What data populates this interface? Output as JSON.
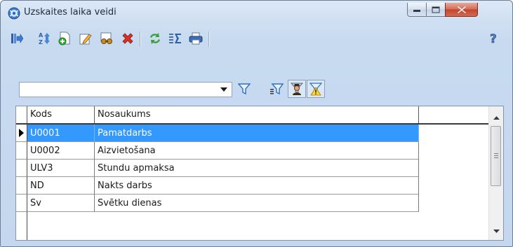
{
  "window": {
    "title": "Uzskaites laika veidi",
    "controls": {
      "minimize": "minimize-icon",
      "maximize": "maximize-icon",
      "close": "close-icon"
    }
  },
  "toolbar": {
    "buttons": [
      {
        "name": "export-icon"
      },
      {
        "name": "sort-az-icon"
      },
      {
        "name": "new-record-icon"
      },
      {
        "name": "edit-icon"
      },
      {
        "name": "view-icon"
      },
      {
        "name": "delete-icon"
      },
      {
        "name": "refresh-icon"
      },
      {
        "name": "sum-icon"
      },
      {
        "name": "print-icon"
      },
      {
        "name": "help-icon"
      }
    ]
  },
  "filter": {
    "combo_value": "",
    "buttons": [
      {
        "name": "filter-icon"
      },
      {
        "name": "filter-list-icon"
      },
      {
        "name": "user-filter-icon",
        "pressed": true
      },
      {
        "name": "warning-filter-icon",
        "pressed": true
      }
    ]
  },
  "grid": {
    "columns": [
      "Kods",
      "Nosaukums"
    ],
    "rows": [
      {
        "kods": "U0001",
        "nosaukums": "Pamatdarbs",
        "selected": true
      },
      {
        "kods": "U0002",
        "nosaukums": "Aizvietošana",
        "selected": false
      },
      {
        "kods": "ULV3",
        "nosaukums": "Stundu apmaksa",
        "selected": false
      },
      {
        "kods": "ND",
        "nosaukums": "Nakts darbs",
        "selected": false
      },
      {
        "kods": "Sv",
        "nosaukums": "Svētku dienas",
        "selected": false
      }
    ]
  },
  "colors": {
    "selection": "#3399ff",
    "close_button": "#c2432b"
  }
}
